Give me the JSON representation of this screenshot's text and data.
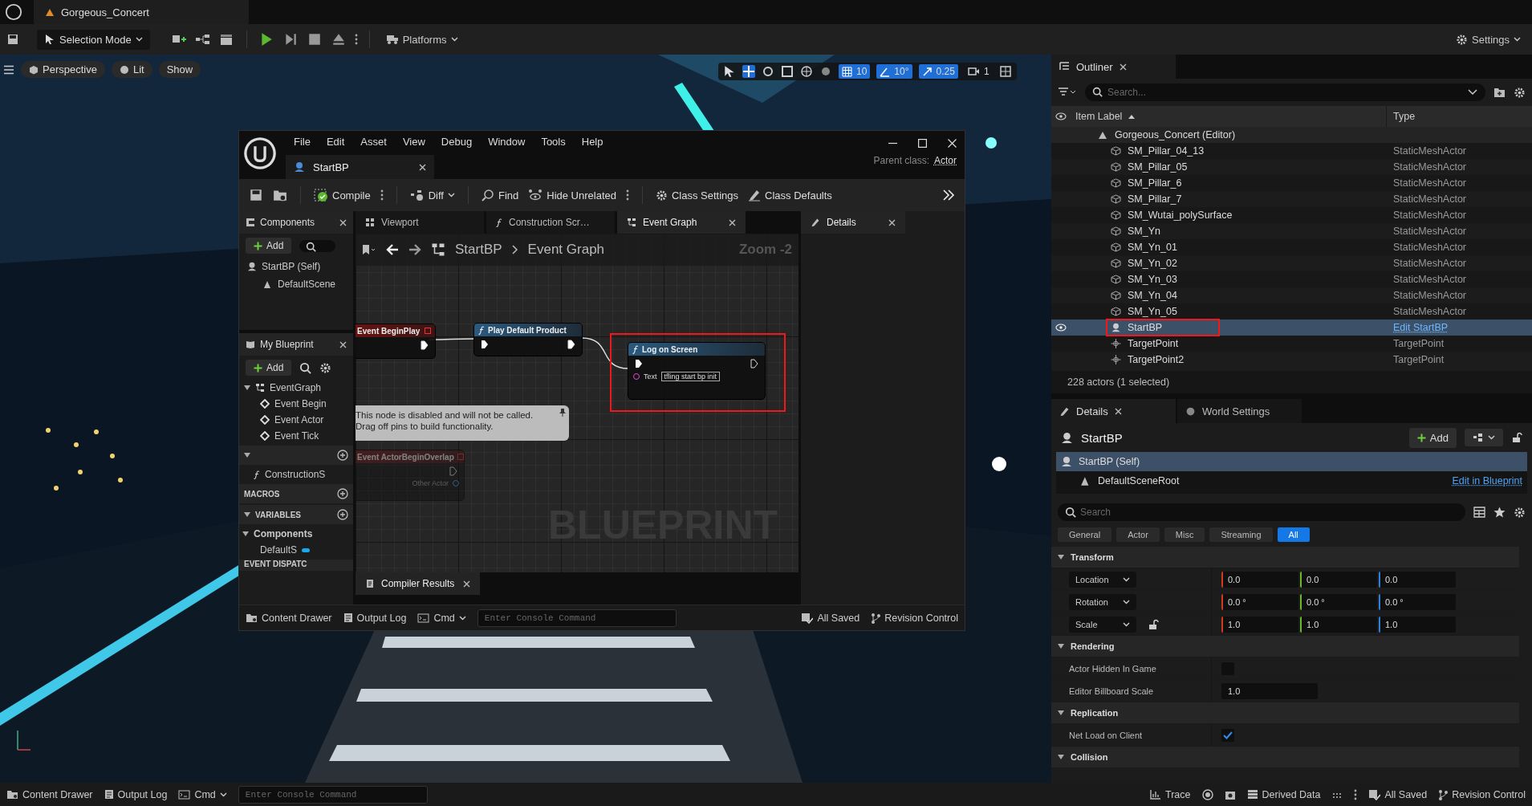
{
  "title_bar": {
    "tab": "Gorgeous_Concert"
  },
  "main_toolbar": {
    "mode": "Selection Mode",
    "platforms": "Platforms",
    "settings": "Settings"
  },
  "viewport": {
    "kind": "picture",
    "toolbar": {
      "view": "Perspective",
      "lighting": "Lit",
      "show": "Show",
      "grid_snap": "10",
      "rotation_snap": "10°",
      "scale_snap": "0.25",
      "camera_speed": "1"
    }
  },
  "blueprint_editor": {
    "menu": [
      "File",
      "Edit",
      "Asset",
      "View",
      "Debug",
      "Window",
      "Tools",
      "Help"
    ],
    "asset_tab": "StartBP",
    "parent_class_label": "Parent class:",
    "parent_class": "Actor",
    "toolbar": [
      {
        "kind": "compile",
        "label": "Compile"
      },
      {
        "kind": "diff",
        "label": "Diff"
      },
      {
        "kind": "find",
        "label": "Find"
      },
      {
        "kind": "hide",
        "label": "Hide Unrelated"
      },
      {
        "kind": "settings",
        "label": "Class Settings"
      },
      {
        "kind": "defaults",
        "label": "Class Defaults"
      }
    ],
    "components": {
      "title": "Components",
      "add": "Add",
      "tree": [
        {
          "label": "StartBP (Self)",
          "children": [
            {
              "label": "DefaultScene"
            }
          ]
        }
      ]
    },
    "my_blueprint": {
      "title": "My Blueprint",
      "add": "Add",
      "graphs": {
        "label": "EventGraph",
        "expanded": true,
        "children": [
          {
            "label": "Event Begin"
          },
          {
            "label": "Event Actor"
          },
          {
            "label": "Event Tick"
          }
        ]
      },
      "functions": {
        "expanded": true,
        "items": [
          "ConstructionS"
        ]
      },
      "macros": {
        "label": "MACROS"
      },
      "variables": {
        "label": "VARIABLES",
        "expanded": true,
        "groups": [
          {
            "label": "Components",
            "expanded": true,
            "children": [
              {
                "label": "DefaultS"
              }
            ]
          }
        ]
      },
      "event_dispatchers": {
        "label": "EVENT DISPATC"
      }
    },
    "graph_tabs": [
      {
        "kind": "viewport",
        "label": "Viewport",
        "selected": false
      },
      {
        "kind": "function",
        "label": "Construction Scr…",
        "selected": false
      },
      {
        "kind": "graph",
        "label": "Event Graph",
        "selected": true
      }
    ],
    "details_tab": "Details",
    "breadcrumb": [
      "StartBP",
      "Event Graph"
    ],
    "zoom": "Zoom -2",
    "nodes": [
      {
        "kind": "event",
        "title": "Event BeginPlay",
        "disabled": false,
        "highlighted": false
      },
      {
        "kind": "function",
        "title": "Play Default Product",
        "disabled": false,
        "highlighted": false
      },
      {
        "kind": "function",
        "title": "Log on Screen",
        "disabled": false,
        "highlighted": true,
        "pins": [
          {
            "label": "Text",
            "value": "tfling start bp init"
          }
        ]
      },
      {
        "kind": "event",
        "title": "Event ActorBeginOverlap",
        "disabled": true,
        "highlighted": false,
        "pins": [
          {
            "label": "Other Actor"
          }
        ]
      }
    ],
    "disabled_note": "This node is disabled and will not be called. Drag off pins to build functionality.",
    "graph_type": "BLUEPRINT",
    "bottom_tab": "Compiler Results",
    "status_bar": {
      "content_drawer": "Content Drawer",
      "output_log": "Output Log",
      "cmd": "Cmd",
      "console_placeholder": "Enter Console Command",
      "saved": "All Saved",
      "revision": "Revision Control"
    }
  },
  "outliner": {
    "title": "Outliner",
    "search_placeholder": "Search...",
    "columns": [
      "Item Label",
      "Type"
    ],
    "root": {
      "label": "Gorgeous_Concert (Editor)",
      "children": [
        {
          "label": "SM_Pillar_04_13",
          "type": "StaticMeshActor",
          "kind": "mesh",
          "selected": false,
          "link": false,
          "highlighted": false
        },
        {
          "label": "SM_Pillar_05",
          "type": "StaticMeshActor",
          "kind": "mesh",
          "selected": false,
          "link": false,
          "highlighted": false
        },
        {
          "label": "SM_Pillar_6",
          "type": "StaticMeshActor",
          "kind": "mesh",
          "selected": false,
          "link": false,
          "highlighted": false
        },
        {
          "label": "SM_Pillar_7",
          "type": "StaticMeshActor",
          "kind": "mesh",
          "selected": false,
          "link": false,
          "highlighted": false
        },
        {
          "label": "SM_Wutai_polySurface",
          "type": "StaticMeshActor",
          "kind": "mesh",
          "selected": false,
          "link": false,
          "highlighted": false
        },
        {
          "label": "SM_Yn",
          "type": "StaticMeshActor",
          "kind": "mesh",
          "selected": false,
          "link": false,
          "highlighted": false
        },
        {
          "label": "SM_Yn_01",
          "type": "StaticMeshActor",
          "kind": "mesh",
          "selected": false,
          "link": false,
          "highlighted": false
        },
        {
          "label": "SM_Yn_02",
          "type": "StaticMeshActor",
          "kind": "mesh",
          "selected": false,
          "link": false,
          "highlighted": false
        },
        {
          "label": "SM_Yn_03",
          "type": "StaticMeshActor",
          "kind": "mesh",
          "selected": false,
          "link": false,
          "highlighted": false
        },
        {
          "label": "SM_Yn_04",
          "type": "StaticMeshActor",
          "kind": "mesh",
          "selected": false,
          "link": false,
          "highlighted": false
        },
        {
          "label": "SM_Yn_05",
          "type": "StaticMeshActor",
          "kind": "mesh",
          "selected": false,
          "link": false,
          "highlighted": false
        },
        {
          "label": "StartBP",
          "type": "Edit StartBP",
          "kind": "blueprint",
          "selected": true,
          "link": true,
          "highlighted": true
        },
        {
          "label": "TargetPoint",
          "type": "TargetPoint",
          "kind": "point",
          "selected": false,
          "link": false,
          "highlighted": false
        },
        {
          "label": "TargetPoint2",
          "type": "TargetPoint",
          "kind": "point",
          "selected": false,
          "link": false,
          "highlighted": false
        }
      ]
    },
    "footer": "228 actors (1 selected)"
  },
  "details": {
    "tabs": [
      {
        "label": "Details",
        "selected": true
      },
      {
        "label": "World Settings",
        "selected": false
      }
    ],
    "actor": "StartBP",
    "add": "Add",
    "components": [
      {
        "label": "StartBP (Self)",
        "selected": true,
        "children": [
          {
            "label": "DefaultSceneRoot",
            "selected": false
          }
        ]
      }
    ],
    "edit_link": "Edit in Blueprint",
    "search_placeholder": "Search",
    "filters": [
      {
        "label": "General",
        "selected": false
      },
      {
        "label": "Actor",
        "selected": false
      },
      {
        "label": "Misc",
        "selected": false
      },
      {
        "label": "Streaming",
        "selected": false
      },
      {
        "label": "All",
        "selected": true
      }
    ],
    "sections": [
      {
        "title": "Transform",
        "expanded": true,
        "rows": [
          {
            "kind": "vector",
            "label": "Location",
            "values": [
              "0.0",
              "0.0",
              "0.0"
            ]
          },
          {
            "kind": "vector",
            "label": "Rotation",
            "values": [
              "0.0 °",
              "0.0 °",
              "0.0 °"
            ]
          },
          {
            "kind": "vector",
            "label": "Scale",
            "values": [
              "1.0",
              "1.0",
              "1.0"
            ],
            "locked": false
          }
        ]
      },
      {
        "title": "Rendering",
        "expanded": true,
        "rows": [
          {
            "kind": "checkbox",
            "label": "Actor Hidden In Game",
            "checked": false
          },
          {
            "kind": "number",
            "label": "Editor Billboard Scale",
            "value": "1.0"
          }
        ]
      },
      {
        "title": "Replication",
        "expanded": true,
        "rows": [
          {
            "kind": "checkbox",
            "label": "Net Load on Client",
            "checked": true
          }
        ]
      },
      {
        "title": "Collision",
        "expanded": true
      }
    ]
  },
  "status_bar": {
    "content_drawer": "Content Drawer",
    "output_log": "Output Log",
    "cmd": "Cmd",
    "console_placeholder": "Enter Console Command",
    "trace": "Trace",
    "derived_data": "Derived Data",
    "saved": "All Saved",
    "revision": "Revision Control"
  }
}
